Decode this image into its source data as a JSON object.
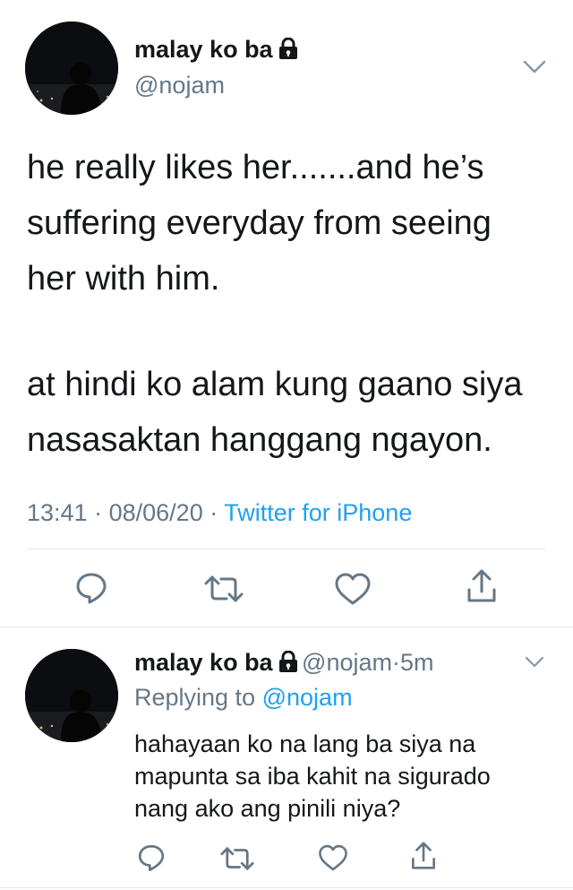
{
  "main_tweet": {
    "display_name": "malay ko ba",
    "handle": "@nojam",
    "text_p1": "he really likes her.......and he’s\nsuffering everyday from seeing\nher with him.",
    "text_p2": "at hindi ko alam kung gaano siya\nnasasaktan hanggang ngayon.",
    "time": "13:41",
    "date": "08/06/20",
    "separator": "·",
    "client": "Twitter for iPhone",
    "icons": [
      "lock-icon",
      "chevron-down-icon",
      "reply-icon",
      "retweet-icon",
      "like-icon",
      "share-icon"
    ]
  },
  "reply_tweet": {
    "display_name": "malay ko ba",
    "handle": "@nojam",
    "separator": "·",
    "age": "5m",
    "replying_label": "Replying to",
    "replying_handle": "@nojam",
    "text": "hahayaan ko na lang ba siya na\nmapunta sa iba kahit na sigurado\nnang ako ang pinili niya?"
  },
  "colors": {
    "accent": "#1da1f2",
    "secondary": "#657786",
    "text": "#14171a",
    "divider": "#e1e8ed"
  }
}
